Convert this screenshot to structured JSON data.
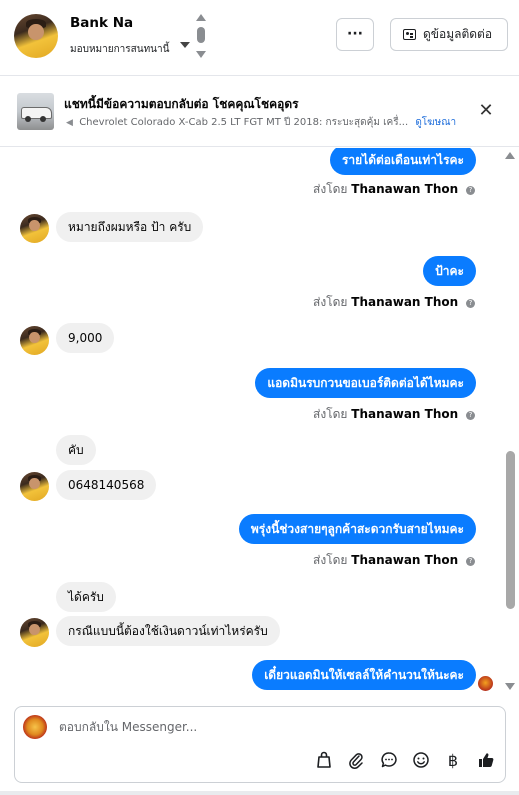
{
  "header": {
    "name": "Bank Na",
    "subtitle": "มอบหมายการสนทนานี้",
    "more_button": "···",
    "contact_button": "ดูข้อมูลติดต่อ"
  },
  "ad": {
    "title": "แชทนี้มีข้อความตอบกลับต่อ โชคคุณโชคอุดร",
    "description": "Chevrolet Colorado X-Cab 2.5 LT FGT MT ปี 2018: กระบะสุดคุ้ม เครื่...",
    "link": "ดูโฆษณา",
    "close": "✕"
  },
  "messages": [
    {
      "dir": "out",
      "text": "รายได้ต่อเดือนเท่าไรคะ"
    },
    {
      "dir": "meta",
      "prefix": "ส่งโดย",
      "name": "Thanawan Thon",
      "info": "?"
    },
    {
      "dir": "in",
      "text": "หมายถึงผมหรือ ป้า ครับ"
    },
    {
      "dir": "out",
      "text": "ป้าคะ"
    },
    {
      "dir": "meta",
      "prefix": "ส่งโดย",
      "name": "Thanawan Thon",
      "info": "?"
    },
    {
      "dir": "in",
      "text": "9,000"
    },
    {
      "dir": "out",
      "text": "แอดมินรบกวนขอเบอร์ติดต่อได้ไหมคะ"
    },
    {
      "dir": "meta",
      "prefix": "ส่งโดย",
      "name": "Thanawan Thon",
      "info": "?"
    },
    {
      "dir": "in",
      "text": "คับ"
    },
    {
      "dir": "in",
      "text": "0648140568"
    },
    {
      "dir": "out",
      "text": "พรุ่งนี้ช่วงสายๆลูกค้าสะดวกรับสายไหมคะ"
    },
    {
      "dir": "meta",
      "prefix": "ส่งโดย",
      "name": "Thanawan Thon",
      "info": "?"
    },
    {
      "dir": "in",
      "text": "ได้ครับ"
    },
    {
      "dir": "in",
      "text": "กรณีแบบนี้ต้องใช้เงินดาวน์เท่าไหร่ครับ"
    },
    {
      "dir": "out",
      "text": "เดี๋ยวแอดมินให้เซลล์ให้คำนวนให้นะคะ"
    }
  ],
  "composer": {
    "placeholder": "ตอบกลับใน Messenger...",
    "tools": [
      "bag-icon",
      "paperclip-icon",
      "chat-bubble-icon",
      "emoji-icon",
      "baht-icon",
      "thumbs-up-icon"
    ]
  },
  "colors": {
    "outgoing_bubble": "#0a7cff",
    "incoming_bubble": "#f0f0f0",
    "link": "#216fdb"
  }
}
